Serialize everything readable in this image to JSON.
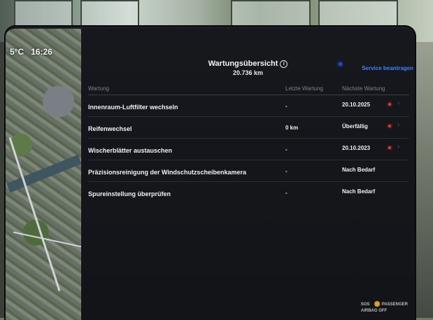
{
  "status_bar": {
    "temperature": "5°C",
    "time": "16:26"
  },
  "header": {
    "title": "Wartungsübersicht",
    "info_icon": "info-icon",
    "odometer": "20.736 km",
    "service_link": "Service beantragen"
  },
  "table": {
    "columns": [
      "Wartung",
      "Letzte Wartung",
      "Nächste Wartung"
    ],
    "rows": [
      {
        "task": "Innenraum-Luftfilter wechseln",
        "last": "-",
        "next": "20.10.2025",
        "alert": true
      },
      {
        "task": "Reifenwechsel",
        "last": "0 km",
        "next": "Überfällig",
        "alert": true
      },
      {
        "task": "Wischerblätter austauschen",
        "last": "-",
        "next": "20.10.2023",
        "alert": true
      },
      {
        "task": "Präzisionsreinigung der Windschutzscheibenkamera",
        "last": "-",
        "next": "Nach Bedarf",
        "alert": false
      },
      {
        "task": "Spureinstellung überprüfen",
        "last": "-",
        "next": "Nach Bedarf",
        "alert": false
      }
    ]
  },
  "footer": {
    "sos": "SOS",
    "badge_line1": "PASSENGER",
    "badge_line2": "AIRBAG OFF"
  },
  "colors": {
    "accent": "#3b82ff",
    "alert": "#e8352c",
    "panel_bg": "#14161b"
  }
}
